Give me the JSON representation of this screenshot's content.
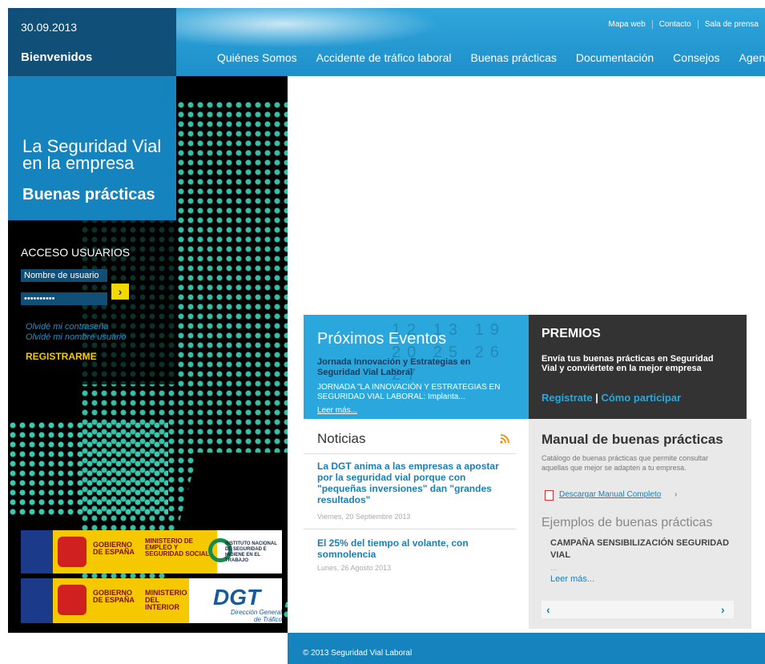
{
  "header": {
    "date": "30.09.2013",
    "welcome": "Bienvenidos",
    "utility_links": [
      "Mapa web",
      "Contacto",
      "Sala de prensa"
    ],
    "nav": [
      "Quiénes Somos",
      "Accidente de tráfico laboral",
      "Buenas prácticas",
      "Documentación",
      "Consejos",
      "Agenda"
    ]
  },
  "hero": {
    "tagline": "La Seguridad Vial en la empresa",
    "subtitle": "Buenas prácticas"
  },
  "login": {
    "title": "ACCESO USUARIOS",
    "username_placeholder": "Nombre de usuario",
    "password_value": "••••••••••",
    "submit_label": "›",
    "forgot_password": "Olvidé mi contraseña",
    "forgot_username": "Olvidé mi nombre usuario",
    "register": "REGISTRARME"
  },
  "logos": {
    "gov1": "GOBIERNO DE ESPAÑA",
    "ministry1": "MINISTERIO DE EMPLEO Y SEGURIDAD SOCIAL",
    "institute": "INSTITUTO NACIONAL DE SEGURIDAD E HIGIENE EN EL TRABAJO",
    "gov2": "GOBIERNO DE ESPAÑA",
    "ministry2": "MINISTERIO DEL INTERIOR",
    "dgt": "DGT",
    "dgt_sub": "Dirección General de Tráfico"
  },
  "events": {
    "title": "Próximos Eventos",
    "headline": "Jornada Innovación y Estrategias en Seguridad Vial Laboral",
    "body": "JORNADA \"LA INNOVACIÓN Y ESTRATEGIAS EN SEGURIDAD VIAL LABORAL: Implanta...",
    "more": "Leer más..."
  },
  "premios": {
    "title": "PREMIOS",
    "body": "Envía tus buenas prácticas en Seguridad Vial y conviértete en la mejor empresa",
    "link1": "Regístrate",
    "separator": "|",
    "link2": "Cómo participar"
  },
  "news": {
    "title": "Noticias",
    "items": [
      {
        "headline": "La DGT anima a las empresas a apostar por la seguridad vial porque con \"pequeñas inversiones\" dan \"grandes resultados\"",
        "date": "Viernes, 20 Septiembre 2013"
      },
      {
        "headline": "El 25% del tiempo al volante, con somnolencia",
        "date": "Lunes, 26 Agosto 2013"
      }
    ]
  },
  "manual": {
    "title": "Manual de buenas prácticas",
    "body": "Catálogo de buenas prácticas que permite consultar aquellas que mejor se adapten a tu empresa.",
    "download": "Descargar Manual Completo",
    "arrow": "›"
  },
  "examples": {
    "title": "Ejemplos de buenas prácticas",
    "item": "CAMPAÑA SENSIBILIZACIÓN SEGURIDAD VIAL",
    "ellipsis": "...",
    "more": "Leer más...",
    "prev": "‹",
    "next": "›"
  },
  "footer": {
    "copyright": "© 2013 Seguridad Vial Laboral"
  },
  "colors": {
    "primary_blue": "#1583bd",
    "accent_yellow": "#f5c800",
    "dark_panel": "#333333"
  }
}
